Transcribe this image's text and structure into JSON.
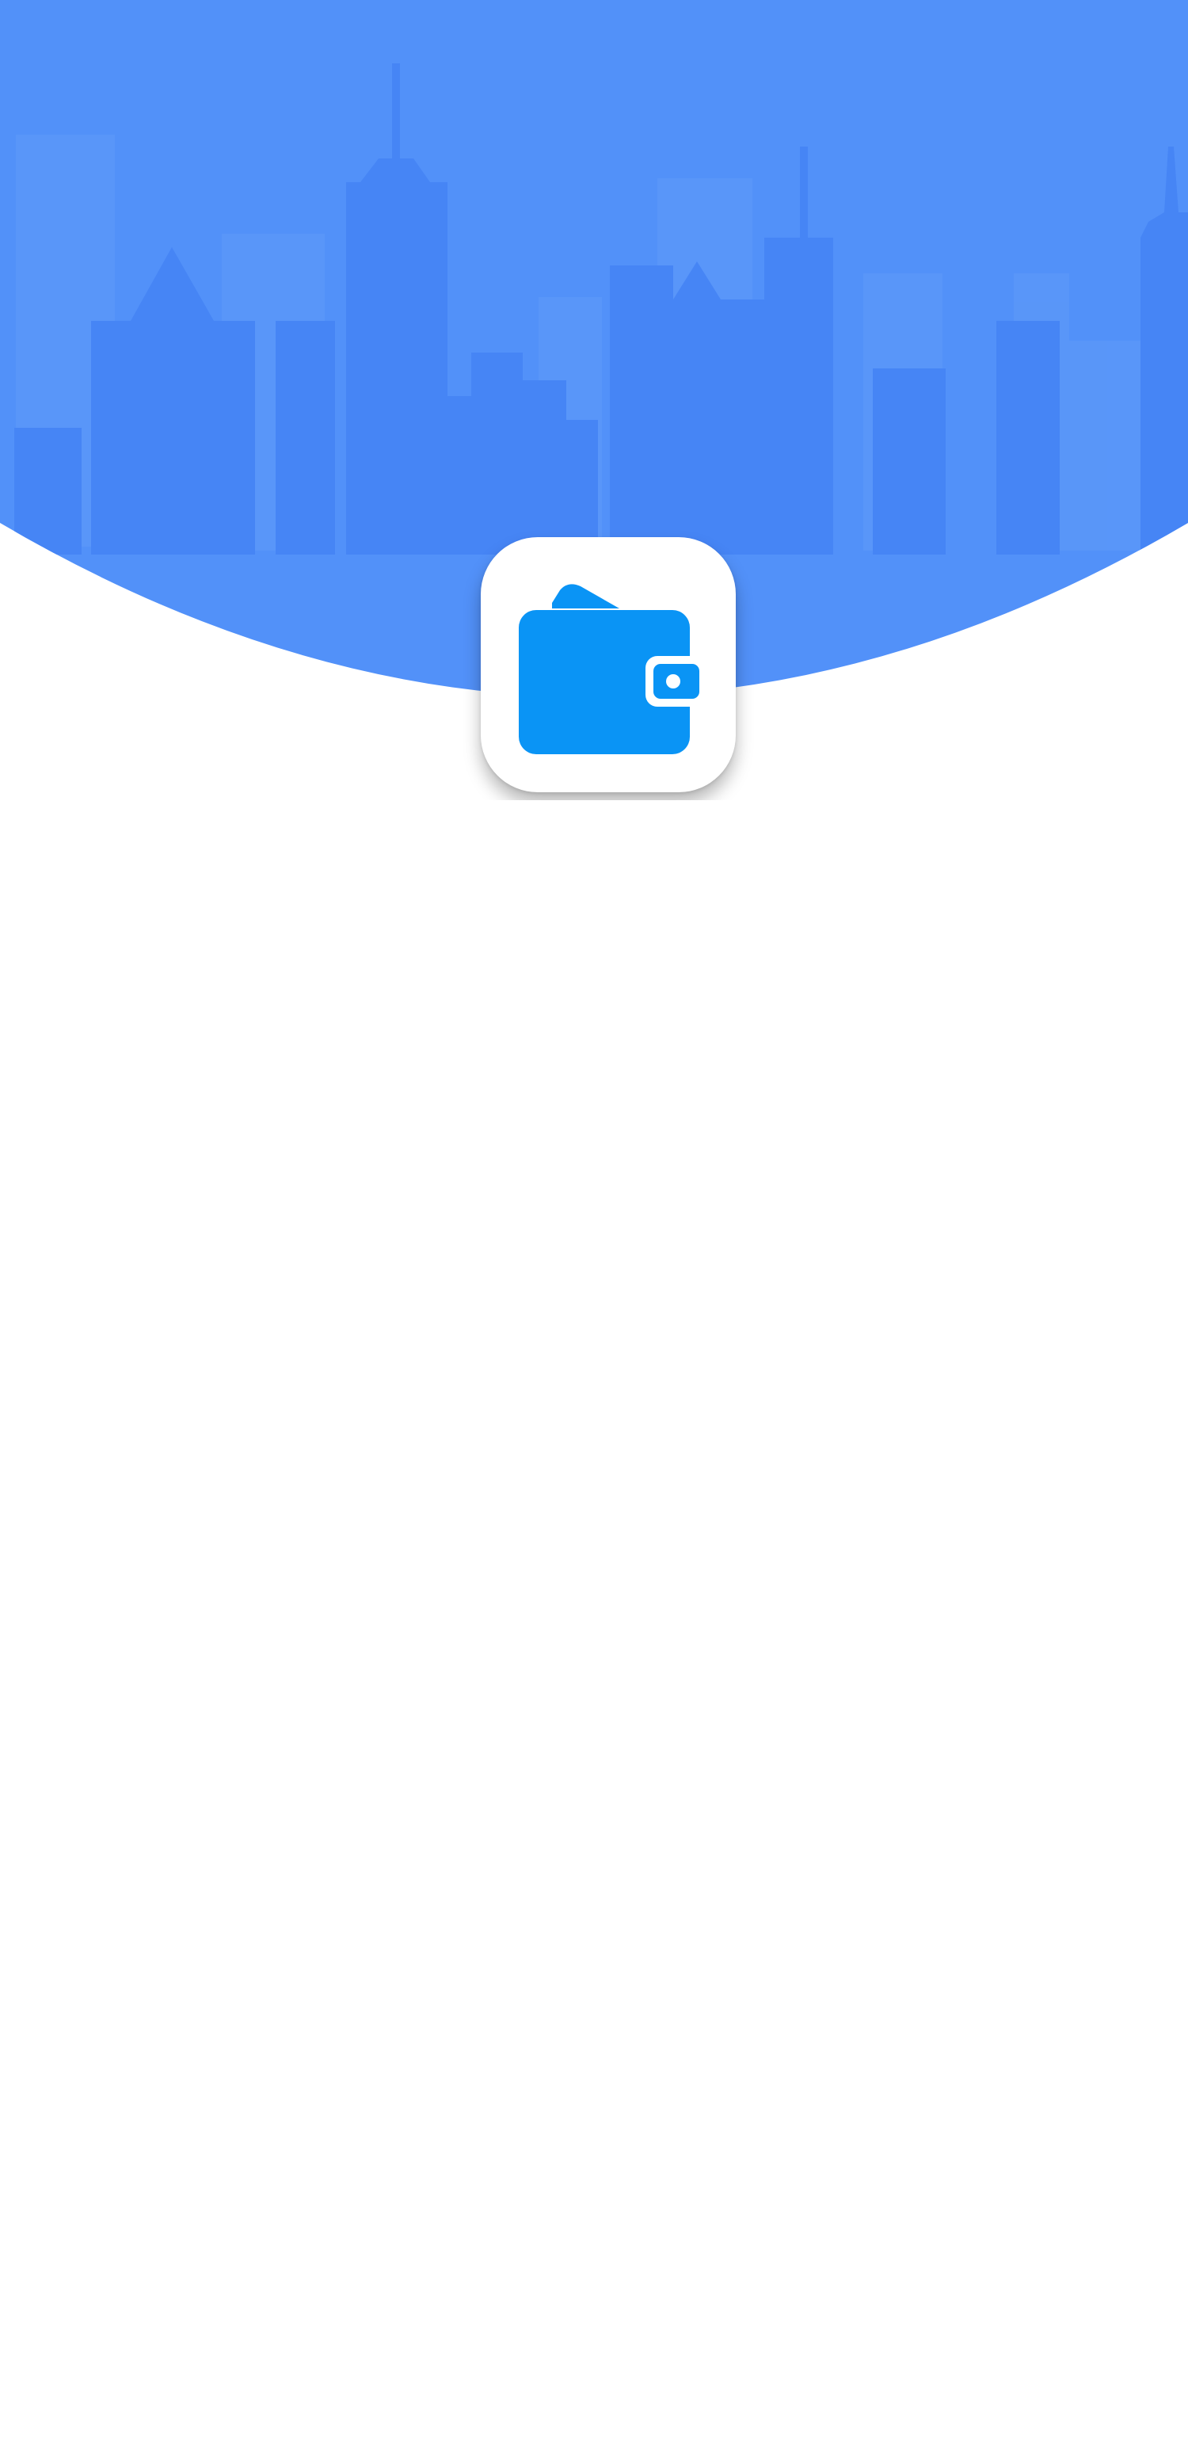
{
  "splash": {
    "background_color": "#5291F9",
    "skyline_color": "#4685F5",
    "icon": {
      "name": "wallet-icon",
      "tile_color": "#FFFFFF",
      "glyph_color": "#0A94F5"
    }
  }
}
